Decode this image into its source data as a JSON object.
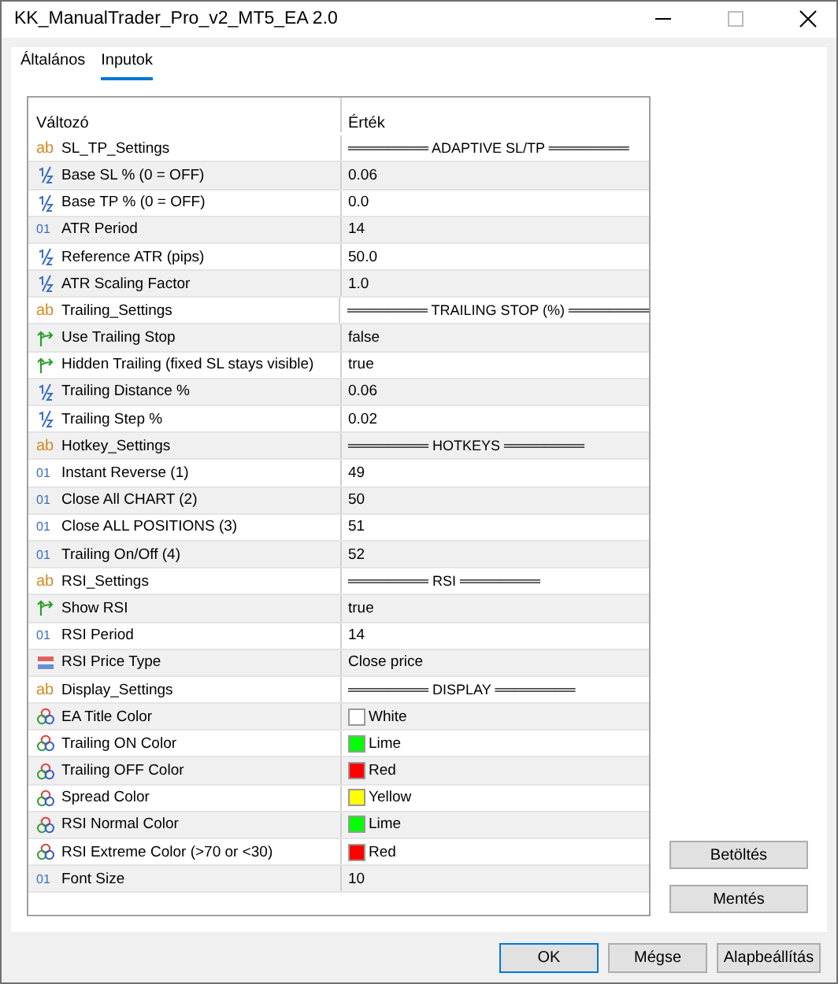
{
  "window": {
    "title": "KK_ManualTrader_Pro_v2_MT5_EA 2.0"
  },
  "tabs": [
    {
      "label": "Általános",
      "selected": false
    },
    {
      "label": "Inputok",
      "selected": true
    }
  ],
  "table": {
    "columns": [
      "Változó",
      "Érték"
    ],
    "rows": [
      {
        "kind": "string",
        "badge": "ab",
        "name": "SL_TP_Settings",
        "value": "════════ ADAPTIVE SL/TP ════════"
      },
      {
        "kind": "double",
        "name": "Base SL % (0 = OFF)",
        "value": "0.06"
      },
      {
        "kind": "double",
        "name": "Base TP % (0 = OFF)",
        "value": "0.0"
      },
      {
        "kind": "int",
        "badge": "01",
        "name": "ATR Period",
        "value": "14"
      },
      {
        "kind": "double",
        "name": "Reference ATR (pips)",
        "value": "50.0"
      },
      {
        "kind": "double",
        "name": "ATR Scaling Factor",
        "value": "1.0"
      },
      {
        "kind": "string",
        "badge": "ab",
        "name": "Trailing_Settings",
        "value": "════════ TRAILING STOP (%) ════════"
      },
      {
        "kind": "bool",
        "name": "Use Trailing Stop",
        "value": "false"
      },
      {
        "kind": "bool",
        "name": "Hidden Trailing (fixed SL stays visible)",
        "value": "true"
      },
      {
        "kind": "double",
        "name": "Trailing Distance %",
        "value": "0.06"
      },
      {
        "kind": "double",
        "name": "Trailing Step %",
        "value": "0.02"
      },
      {
        "kind": "string",
        "badge": "ab",
        "name": "Hotkey_Settings",
        "value": "════════ HOTKEYS ════════"
      },
      {
        "kind": "int",
        "badge": "01",
        "name": "Instant Reverse (1)",
        "value": "49"
      },
      {
        "kind": "int",
        "badge": "01",
        "name": "Close All CHART (2)",
        "value": "50"
      },
      {
        "kind": "int",
        "badge": "01",
        "name": "Close ALL POSITIONS (3)",
        "value": "51"
      },
      {
        "kind": "int",
        "badge": "01",
        "name": "Trailing On/Off (4)",
        "value": "52"
      },
      {
        "kind": "string",
        "badge": "ab",
        "name": "RSI_Settings",
        "value": "════════ RSI ════════"
      },
      {
        "kind": "bool",
        "name": "Show RSI",
        "value": "true"
      },
      {
        "kind": "int",
        "badge": "01",
        "name": "RSI Period",
        "value": "14"
      },
      {
        "kind": "enum",
        "name": "RSI Price Type",
        "value": "Close price"
      },
      {
        "kind": "string",
        "badge": "ab",
        "name": "Display_Settings",
        "value": "════════ DISPLAY ════════"
      },
      {
        "kind": "color",
        "name": "EA Title Color",
        "value": "White",
        "color": "#ffffff"
      },
      {
        "kind": "color",
        "name": "Trailing ON Color",
        "value": "Lime",
        "color": "#00ff00"
      },
      {
        "kind": "color",
        "name": "Trailing OFF Color",
        "value": "Red",
        "color": "#ff0000"
      },
      {
        "kind": "color",
        "name": "Spread Color",
        "value": "Yellow",
        "color": "#ffff00"
      },
      {
        "kind": "color",
        "name": "RSI Normal Color",
        "value": "Lime",
        "color": "#00ff00"
      },
      {
        "kind": "color",
        "name": "RSI Extreme Color (>70 or <30)",
        "value": "Red",
        "color": "#ff0000"
      },
      {
        "kind": "int",
        "badge": "01",
        "name": "Font Size",
        "value": "10"
      }
    ]
  },
  "side_buttons": [
    "Betöltés",
    "Mentés"
  ],
  "buttons": [
    {
      "label": "OK",
      "default": true
    },
    {
      "label": "Mégse",
      "default": false
    },
    {
      "label": "Alapbeállítás",
      "default": false
    }
  ]
}
